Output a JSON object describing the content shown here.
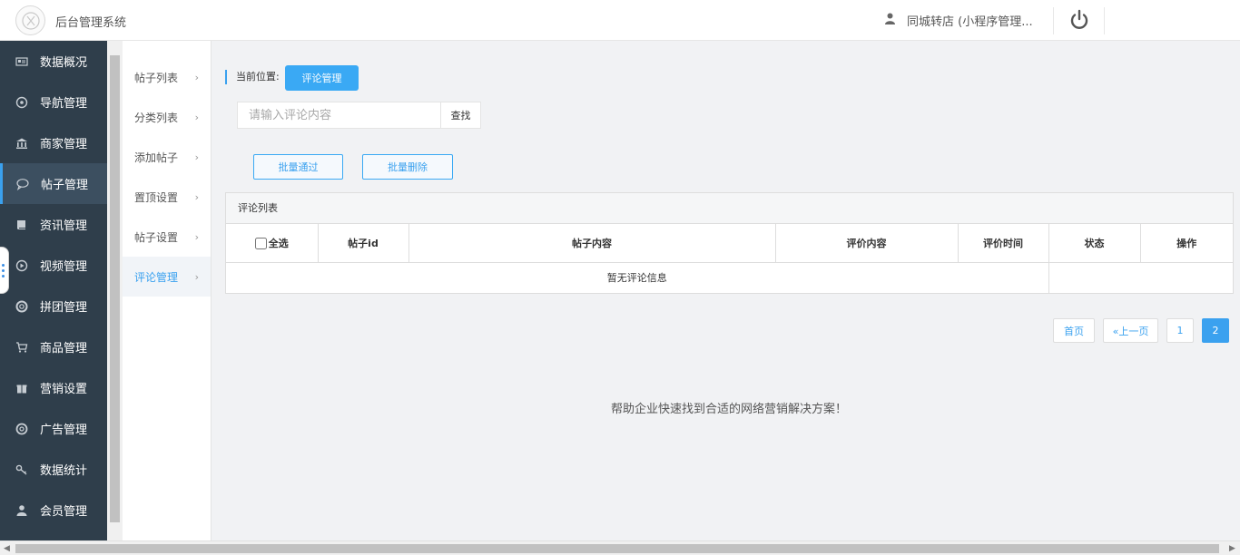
{
  "header": {
    "app_title": "后台管理系统",
    "user_name": "同城转店 (小程序管理..."
  },
  "sidebar": {
    "items": [
      {
        "label": "数据概况",
        "icon": "dashboard-icon"
      },
      {
        "label": "导航管理",
        "icon": "compass-icon"
      },
      {
        "label": "商家管理",
        "icon": "bank-icon"
      },
      {
        "label": "帖子管理",
        "icon": "chat-bubble-icon",
        "active": true
      },
      {
        "label": "资讯管理",
        "icon": "book-icon"
      },
      {
        "label": "视频管理",
        "icon": "play-circle-icon"
      },
      {
        "label": "拼团管理",
        "icon": "lifebuoy-icon"
      },
      {
        "label": "商品管理",
        "icon": "cart-icon"
      },
      {
        "label": "营销设置",
        "icon": "gift-icon"
      },
      {
        "label": "广告管理",
        "icon": "globe-icon"
      },
      {
        "label": "数据统计",
        "icon": "key-icon"
      },
      {
        "label": "会员管理",
        "icon": "user-icon"
      }
    ]
  },
  "submenu": {
    "items": [
      {
        "label": "帖子列表"
      },
      {
        "label": "分类列表"
      },
      {
        "label": "添加帖子"
      },
      {
        "label": "置顶设置"
      },
      {
        "label": "帖子设置"
      },
      {
        "label": "评论管理",
        "active": true
      }
    ]
  },
  "main": {
    "crumb_label": "当前位置:",
    "crumb_current": "评论管理",
    "search_placeholder": "请输入评论内容",
    "search_button": "查找",
    "batch_approve": "批量通过",
    "batch_delete": "批量删除",
    "panel_title": "评论列表",
    "table": {
      "select_all": "全选",
      "columns": [
        "帖子id",
        "帖子内容",
        "评价内容",
        "评价时间",
        "状态",
        "操作"
      ],
      "empty_text": "暂无评论信息"
    },
    "pagination": {
      "first": "首页",
      "prev": "«上一页",
      "pages": [
        "1",
        "2"
      ],
      "current": "2"
    },
    "footer_text": "帮助企业快速找到合适的网络营销解决方案！"
  },
  "colors": {
    "sidebar_bg": "#2f3e4b",
    "accent": "#3aa1ef"
  }
}
